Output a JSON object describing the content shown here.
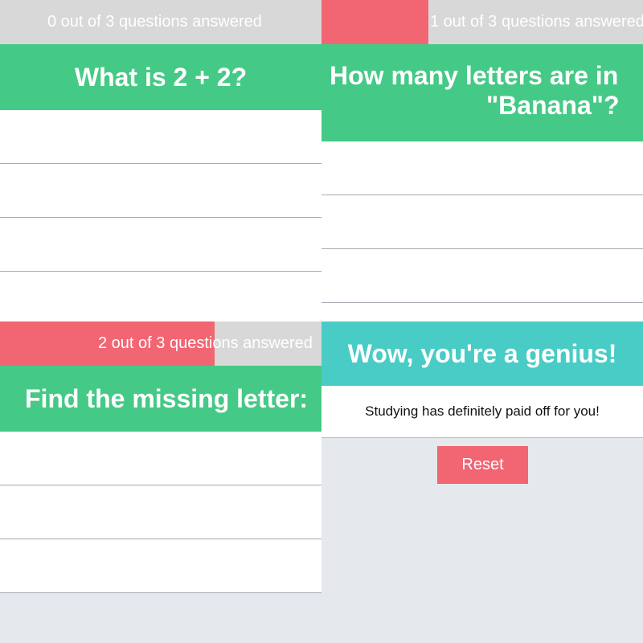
{
  "colors": {
    "progress_track": "#d8d8d8",
    "progress_fill": "#f26572",
    "question_bg": "#45c986",
    "result_bg": "#48ccc5",
    "reset_bg": "#f26572",
    "page_bg": "#e5e8ec"
  },
  "panels": [
    {
      "progress": {
        "text": "0 out of 3 questions answered",
        "answered": 0,
        "total": 3
      },
      "question": "What is 2 + 2?",
      "answers_visible": 4
    },
    {
      "progress": {
        "text": "1 out of 3 questions answered",
        "answered": 1,
        "total": 3
      },
      "question": "How many letters are in \"Banana\"?",
      "question_lines": [
        "How many letters are in",
        "\"Banana\"?"
      ],
      "answers_visible": 4
    },
    {
      "progress": {
        "text": "2 out of 3 questions answered",
        "answered": 2,
        "total": 3
      },
      "question": "Find the missing letter:",
      "answers_visible": 3
    }
  ],
  "result": {
    "heading": "Wow, you're a genius!",
    "message": "Studying has definitely paid off for you!",
    "reset_label": "Reset"
  }
}
